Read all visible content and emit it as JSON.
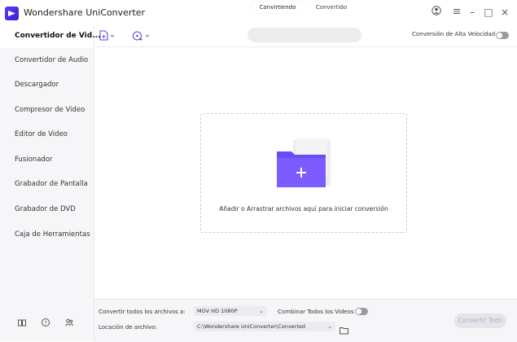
{
  "app": {
    "title": "Wondershare UniConverter"
  },
  "window": {
    "avatar_icon": "user-circle-icon",
    "menu_icon": "hamburger-icon",
    "minimize_glyph": "–",
    "maximize_glyph": "□",
    "close_glyph": "×"
  },
  "sidebar": {
    "items": [
      {
        "label": "Convertidor de Vid...",
        "active": true
      },
      {
        "label": "Convertidor de Audio"
      },
      {
        "label": "Descargador"
      },
      {
        "label": "Compresor de Video"
      },
      {
        "label": "Editor de Video"
      },
      {
        "label": "Fusionador"
      },
      {
        "label": "Grabador de Pantalla"
      },
      {
        "label": "Grabador de DVD"
      },
      {
        "label": "Caja de Herramientas"
      }
    ],
    "bottom_icons": [
      "book-icon",
      "help-icon",
      "account-icon"
    ]
  },
  "toolbar": {
    "tabs": {
      "converting": "Convirtiendo",
      "converted": "Convertido"
    },
    "high_speed_label": "Conversión de Alta Velocidad"
  },
  "main": {
    "drop_text": "Añadir o Arrastrar archivos aquí para iniciar conversión",
    "folder_icon": "add-folder-icon"
  },
  "bottom": {
    "convert_all_label": "Convertir todos los archivos a:",
    "format_value": "MOV HD 1080P",
    "merge_label": "Combinar Todos los Videos",
    "location_label": "Locación de archivo:",
    "path_value": "C:\\Wondershare UniConverter\\Converted",
    "convert_button": "Convertir Todo"
  },
  "colors": {
    "accent": "#5b3cff",
    "sidebar_bg": "#f6f6f8",
    "folder": "#6a4cf5"
  }
}
